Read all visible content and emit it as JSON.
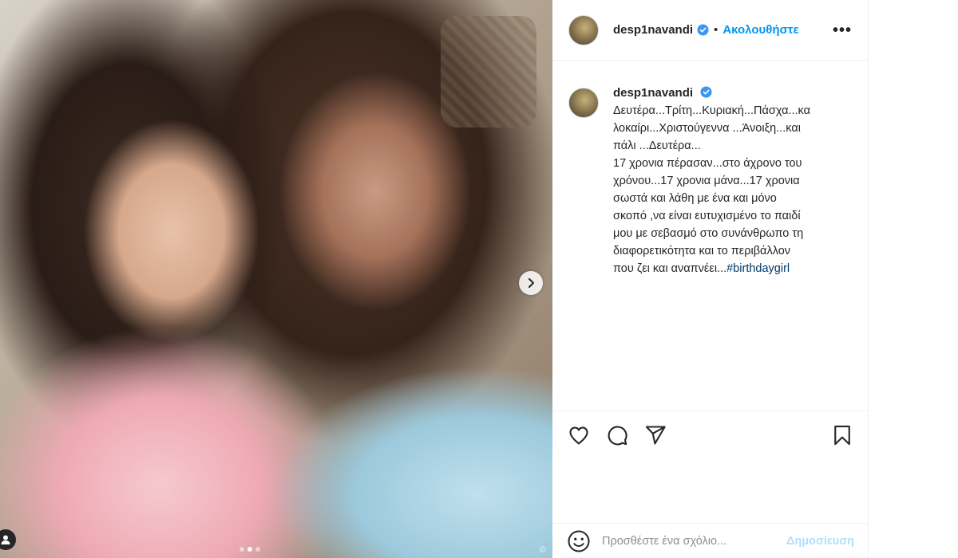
{
  "post": {
    "username": "desp1navandi",
    "follow_label": "Ακολουθήστε",
    "separator": "•",
    "more_label": "•••",
    "verified_icon": "verified-badge-icon",
    "caption_text": "Δευτέρα...Τρίτη...Κυριακή...Πάσχα...κα\nλοκαίρι...Χριστούγεννα ...Άνοιξη...και\nπάλι ...Δευτέρα...\n17 χρονια πέρασαν...στο άχρονο του\nχρόνου...17 χρονια μάνα...17 χρονια\nσωστά και λάθη με ένα και μόνο\nσκοπό ,να είναι ευτυχισμένο το παιδί\nμου με σεβασμό στο συνάνθρωπο τη\nδιαφορετικότητα και το περιβάλλον\nπου ζει και αναπνέει...",
    "hashtag": "#birthdaygirl"
  },
  "photo": {
    "copyright": "©",
    "carousel": {
      "total": 3,
      "active": 1
    }
  },
  "actions": {
    "like_icon": "heart-icon",
    "comment_icon": "comment-icon",
    "share_icon": "share-icon",
    "save_icon": "bookmark-icon"
  },
  "comment": {
    "placeholder": "Προσθέστε ένα σχόλιο...",
    "post_label": "Δημοσίευση"
  },
  "colors": {
    "accent": "#0095f6",
    "post_disabled": "#b2dffc",
    "text": "#262626",
    "muted": "#8e8e8e",
    "border": "#efefef"
  }
}
